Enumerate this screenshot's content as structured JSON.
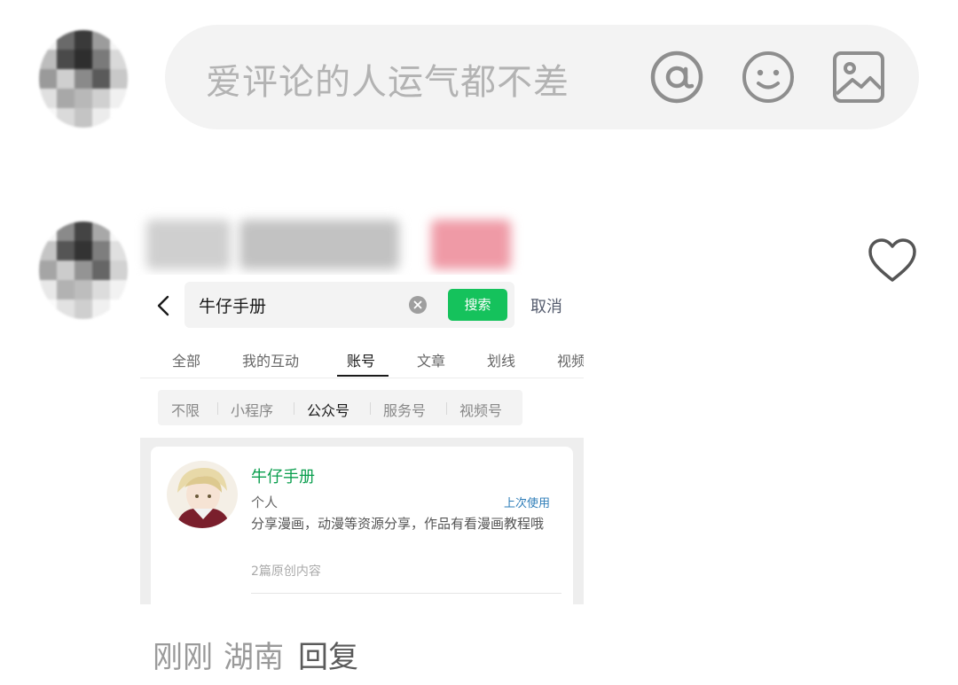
{
  "comment_input": {
    "placeholder": "爱评论的人运气都不差",
    "icons": [
      "at-icon",
      "emoji-icon",
      "image-icon"
    ]
  },
  "comment": {
    "like_icon": "heart-icon",
    "screenshot": {
      "search": {
        "query": "牛仔手册",
        "button_label": "搜索",
        "cancel_label": "取消"
      },
      "tabs": [
        {
          "label": "全部"
        },
        {
          "label": "我的互动"
        },
        {
          "label": "账号",
          "active": true
        },
        {
          "label": "文章"
        },
        {
          "label": "划线"
        },
        {
          "label": "视频"
        }
      ],
      "filters": [
        {
          "label": "不限"
        },
        {
          "label": "小程序"
        },
        {
          "label": "公众号",
          "active": true
        },
        {
          "label": "服务号"
        },
        {
          "label": "视频号"
        }
      ],
      "result": {
        "name": "牛仔手册",
        "type": "个人",
        "recent": "上次使用",
        "description": "分享漫画，动漫等资源分享，作品有看漫画教程哦",
        "count": "2篇原创内容"
      }
    },
    "meta": {
      "time": "刚刚",
      "location": "湖南",
      "reply_label": "回复"
    }
  },
  "colors": {
    "brand_green": "#15c25c",
    "name_green": "#0a9e4e",
    "link_blue": "#2e7db8",
    "input_bg": "#f3f3f3"
  }
}
